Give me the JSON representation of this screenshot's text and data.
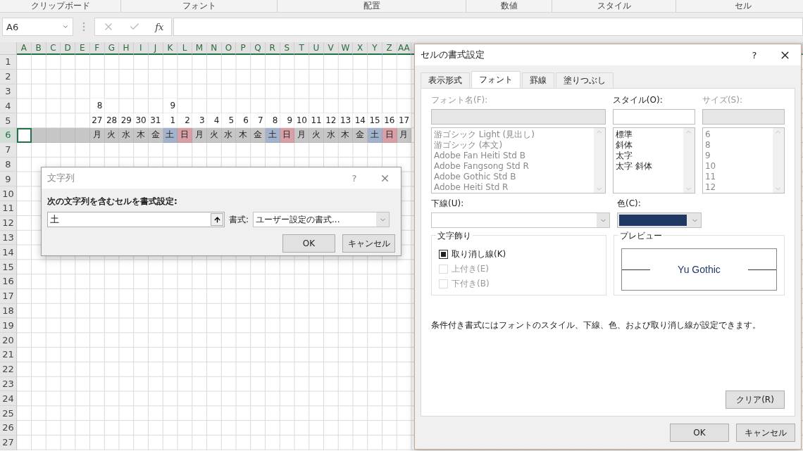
{
  "ribbon_groups": [
    "クリップボード",
    "フォント",
    "配置",
    "数値",
    "スタイル",
    "セル"
  ],
  "formula_bar": {
    "name_box": "A6",
    "function_label": "fx"
  },
  "sheet": {
    "columns": [
      "A",
      "B",
      "C",
      "D",
      "E",
      "F",
      "G",
      "H",
      "I",
      "J",
      "K",
      "L",
      "M",
      "N",
      "O",
      "P",
      "Q",
      "R",
      "S",
      "T",
      "U",
      "V",
      "W",
      "X",
      "Y",
      "Z",
      "AA"
    ],
    "rows": [
      {
        "number": "1",
        "selected": false
      },
      {
        "number": "2",
        "selected": false
      },
      {
        "number": "3",
        "selected": false
      },
      {
        "number": "4",
        "selected": false,
        "cells": [
          null,
          null,
          null,
          null,
          null,
          "8",
          null,
          null,
          null,
          null,
          "9"
        ]
      },
      {
        "number": "5",
        "selected": false,
        "cells": [
          null,
          null,
          null,
          null,
          null,
          "27",
          "28",
          "29",
          "30",
          "31",
          "1",
          "2",
          "3",
          "4",
          "5",
          "6",
          "7",
          "8",
          "9",
          "10",
          "11",
          "12",
          "13",
          "14",
          "15",
          "16",
          "17"
        ]
      },
      {
        "number": "6",
        "selected": true,
        "cells": [
          null,
          null,
          null,
          null,
          null,
          {
            "text": "月"
          },
          {
            "text": "火"
          },
          {
            "text": "水"
          },
          {
            "text": "木"
          },
          {
            "text": "金"
          },
          {
            "text": "土",
            "color": "#a3b3cc"
          },
          {
            "text": "日",
            "color": "#d8a0a6"
          },
          {
            "text": "月"
          },
          {
            "text": "火"
          },
          {
            "text": "水"
          },
          {
            "text": "木"
          },
          {
            "text": "金"
          },
          {
            "text": "土",
            "color": "#a3b3cc"
          },
          {
            "text": "日",
            "color": "#d8a0a6"
          },
          {
            "text": "月"
          },
          {
            "text": "火"
          },
          {
            "text": "水"
          },
          {
            "text": "木"
          },
          {
            "text": "金"
          },
          {
            "text": "土",
            "color": "#a3b3cc"
          },
          {
            "text": "日",
            "color": "#d8a0a6"
          },
          {
            "text": "月"
          }
        ]
      },
      {
        "number": "7",
        "selected": false
      },
      {
        "number": "8",
        "selected": false
      },
      {
        "number": "9",
        "selected": false
      },
      {
        "number": "10",
        "selected": false
      },
      {
        "number": "11",
        "selected": false
      },
      {
        "number": "12",
        "selected": false
      },
      {
        "number": "13",
        "selected": false
      },
      {
        "number": "14",
        "selected": false
      },
      {
        "number": "15",
        "selected": false
      },
      {
        "number": "16",
        "selected": false
      },
      {
        "number": "17",
        "selected": false
      },
      {
        "number": "18",
        "selected": false
      },
      {
        "number": "19",
        "selected": false
      },
      {
        "number": "20",
        "selected": false
      },
      {
        "number": "21",
        "selected": false
      },
      {
        "number": "22",
        "selected": false
      },
      {
        "number": "23",
        "selected": false
      },
      {
        "number": "24",
        "selected": false
      },
      {
        "number": "25",
        "selected": false
      },
      {
        "number": "26",
        "selected": false
      },
      {
        "number": "27",
        "selected": false
      }
    ]
  },
  "find_dialog": {
    "title": "文字列",
    "help": "?",
    "prompt": "次の文字列を含むセルを書式設定:",
    "value": "土",
    "format_label": "書式:",
    "format_value": "ユーザー設定の書式...",
    "buttons": [
      "OK",
      "キャンセル"
    ]
  },
  "format_dialog": {
    "title": "セルの書式設定",
    "help": "?",
    "tabs": [
      {
        "label": "表示形式",
        "selected": false
      },
      {
        "label": "フォント",
        "selected": true
      },
      {
        "label": "罫線",
        "selected": false
      },
      {
        "label": "塗りつぶし",
        "selected": false
      }
    ],
    "font": {
      "label": "フォント名(F):",
      "disabled": true,
      "items": [
        "游ゴシック Light (見出し)",
        "游ゴシック (本文)",
        "Adobe Fan Heiti Std B",
        "Adobe Fangsong Std R",
        "Adobe Gothic Std B",
        "Adobe Heiti Std R"
      ]
    },
    "style": {
      "label": "スタイル(O):",
      "disabled": false,
      "items": [
        "標準",
        "斜体",
        "太字",
        "太字 斜体"
      ]
    },
    "size": {
      "label": "サイズ(S):",
      "disabled": true,
      "items": [
        "6",
        "8",
        "9",
        "10",
        "11",
        "12"
      ]
    },
    "underline": {
      "label": "下線(U):"
    },
    "color": {
      "label": "色(C):",
      "color": "#1f3864"
    },
    "effects": {
      "title": "文字飾り",
      "items": [
        {
          "label": "取り消し線(K)",
          "checked": true,
          "disabled": false
        },
        {
          "label": "上付き(E)",
          "checked": false,
          "disabled": true
        },
        {
          "label": "下付き(B)",
          "checked": false,
          "disabled": true
        }
      ]
    },
    "preview": {
      "title": "プレビュー",
      "text": "Yu Gothic"
    },
    "note": "条件付き書式にはフォントのスタイル、下線、色、および取り消し線が設定できます。",
    "clear_button": "クリア(R)",
    "buttons": [
      "OK",
      "キャンセル"
    ]
  }
}
